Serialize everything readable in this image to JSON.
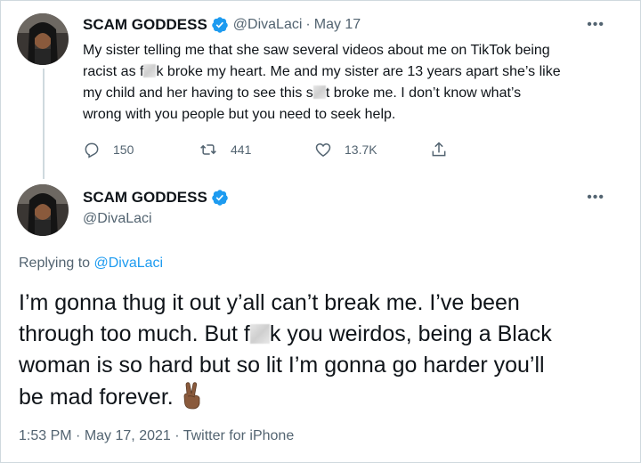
{
  "tweet1": {
    "name": "SCAM GODDESS",
    "handle": "@DivaLaci",
    "separator": "·",
    "date": "May 17",
    "more_label": "•••",
    "text": {
      "l1": "My sister telling me that she saw several videos about me on TikTok being",
      "l2a": "racist as f",
      "l2b": "k broke my heart. Me and my sister are 13 years apart she’s like",
      "l3a": "my child and her having to see this s",
      "l3b": "t broke me. I don’t know what’s",
      "l4": "wrong with you people but you need to seek help."
    },
    "actions": {
      "replies": "150",
      "retweets": "441",
      "likes": "13.7K"
    }
  },
  "tweet2": {
    "name": "SCAM GODDESS",
    "handle": "@DivaLaci",
    "more_label": "•••",
    "replying_prefix": "Replying to ",
    "replying_to": "@DivaLaci",
    "text": {
      "l1": "I’m gonna thug it out y’all can’t break me. I’ve been",
      "l2a": "through too much. But f",
      "l2b": "k you weirdos, being a Black",
      "l3": "woman is so hard but so lit I’m gonna go harder you’ll",
      "l4": "be mad forever."
    },
    "meta": {
      "time": "1:53 PM",
      "separator": "·",
      "date": "May 17, 2021",
      "separator2": "·",
      "client": "Twitter for iPhone"
    }
  },
  "colors": {
    "accent": "#1d9bf0",
    "secondary_text": "#536471",
    "primary_text": "#0f1419",
    "border": "#cfd9de"
  },
  "icons": [
    "verified-badge-icon",
    "reply-icon",
    "retweet-icon",
    "like-icon",
    "share-icon",
    "more-icon",
    "peace-sign-emoji"
  ]
}
